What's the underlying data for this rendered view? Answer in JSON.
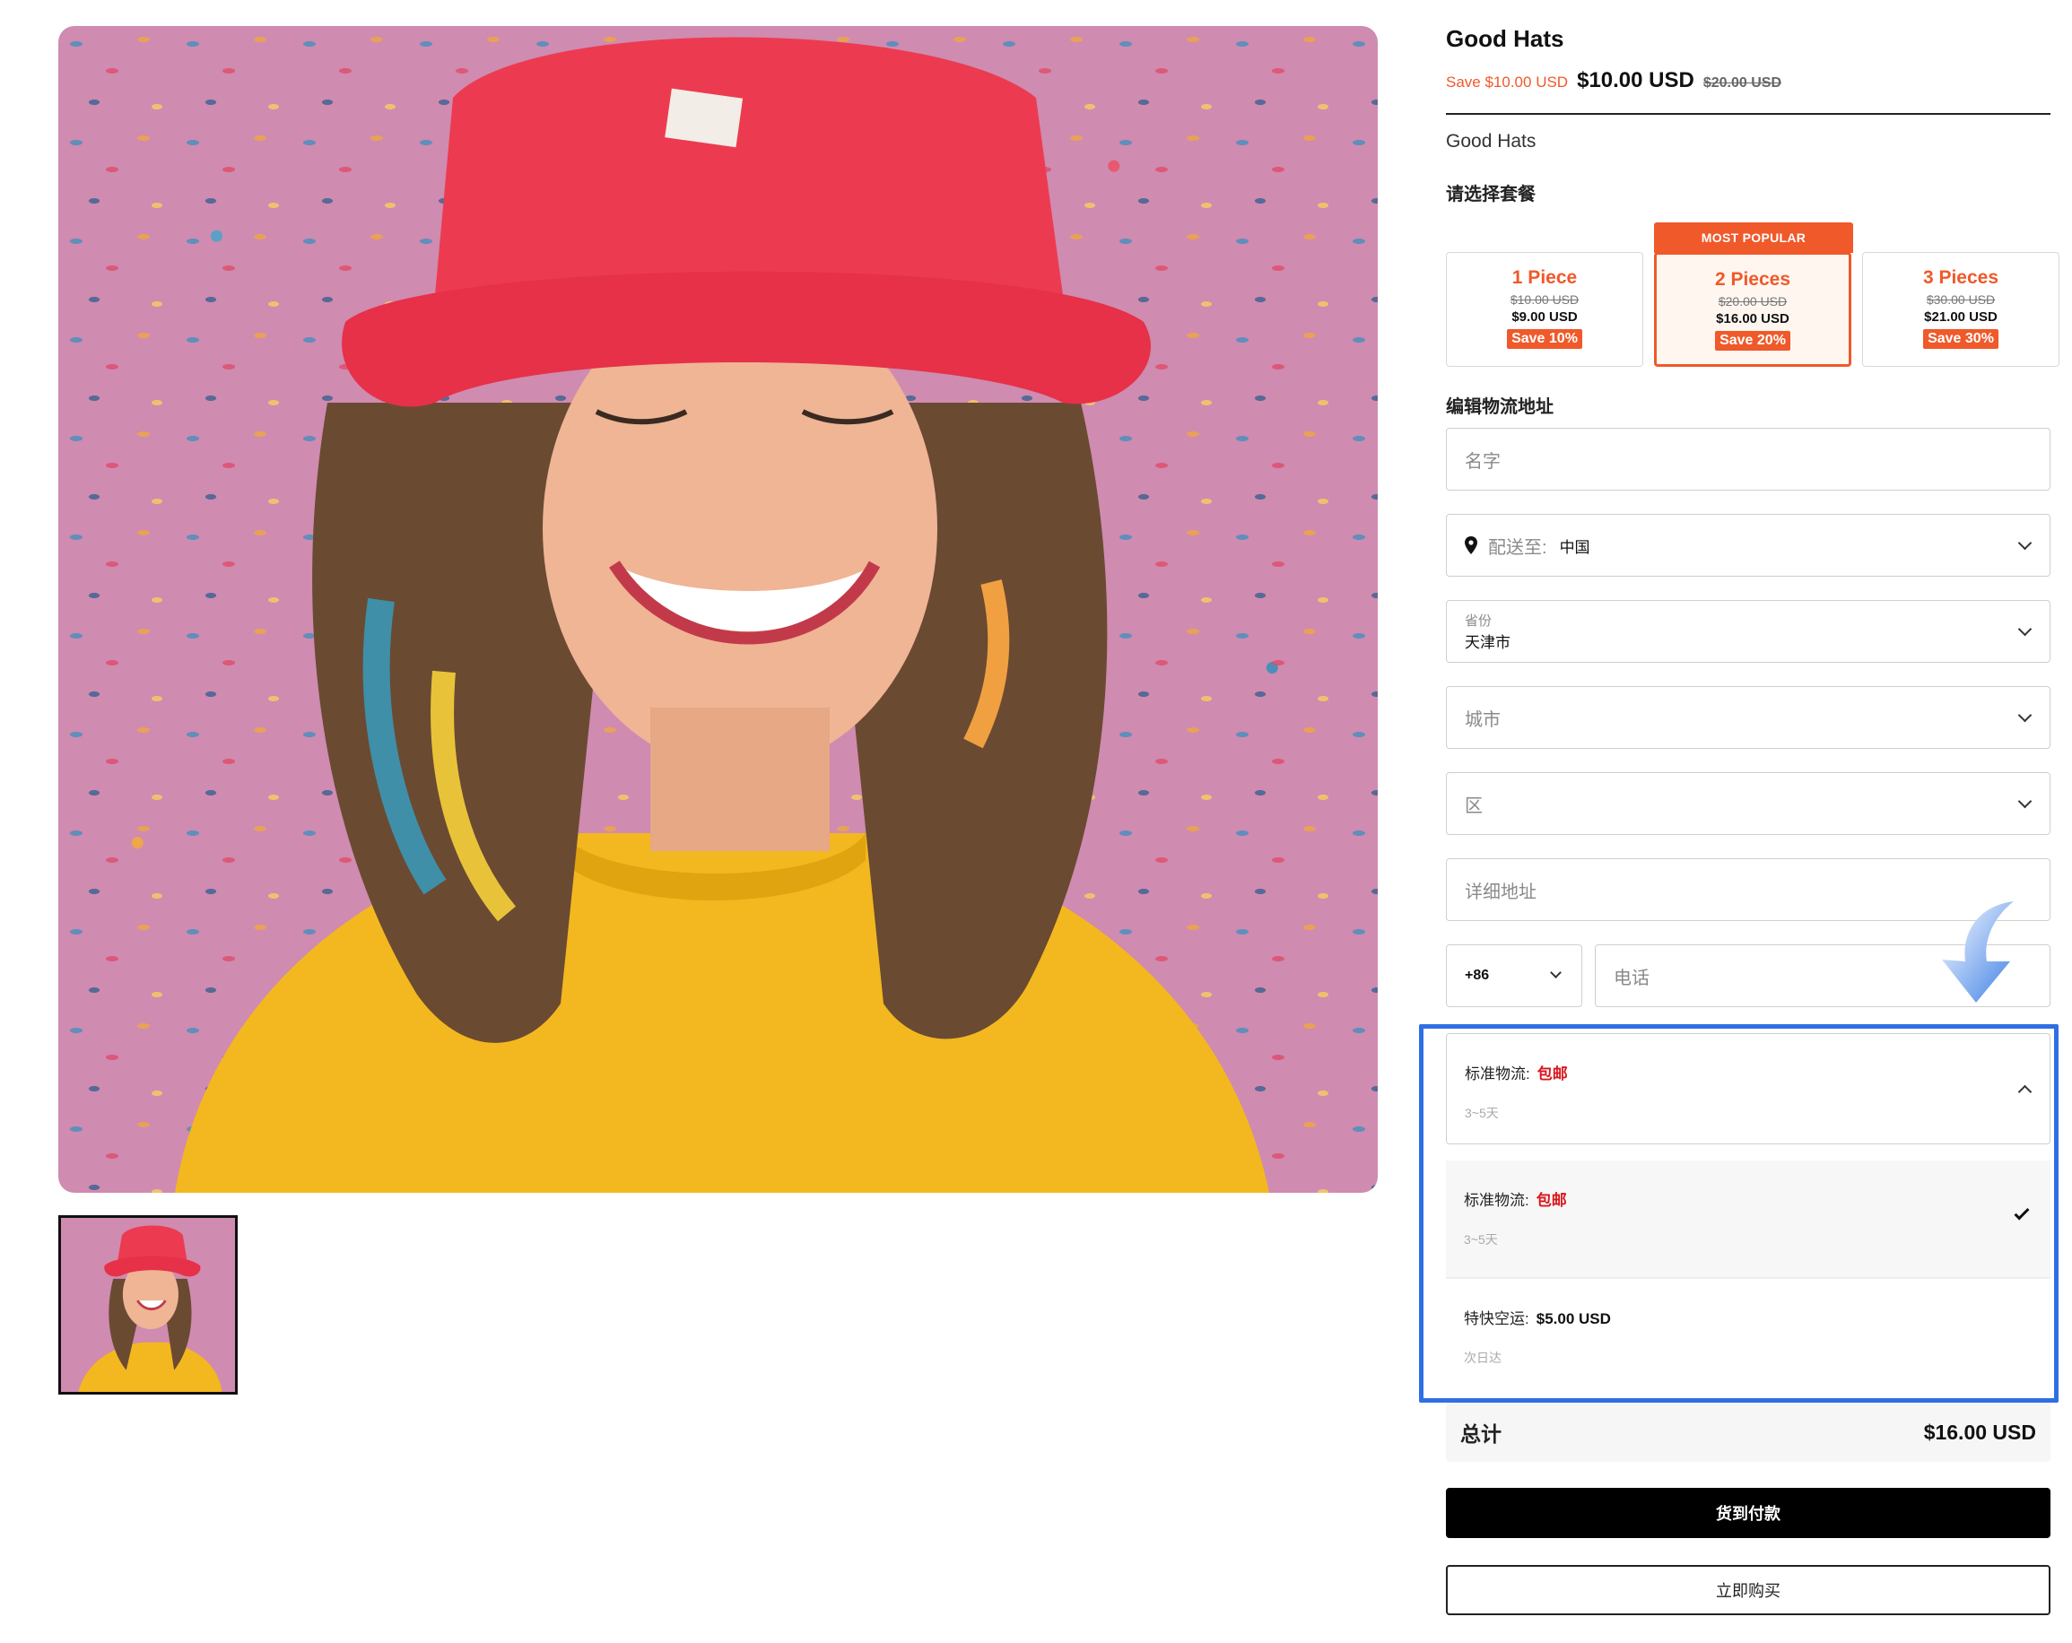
{
  "product": {
    "title": "Good Hats",
    "save_text": "Save $10.00 USD",
    "price": "$10.00 USD",
    "compare_price": "$20.00 USD",
    "subtitle": "Good Hats"
  },
  "bundle_section": {
    "label": "请选择套餐",
    "badge": "MOST POPULAR",
    "options": [
      {
        "name": "1 Piece",
        "old": "$10.00 USD",
        "new": "$9.00 USD",
        "save": "Save 10%"
      },
      {
        "name": "2 Pieces",
        "old": "$20.00 USD",
        "new": "$16.00 USD",
        "save": "Save 20%"
      },
      {
        "name": "3 Pieces",
        "old": "$30.00 USD",
        "new": "$21.00 USD",
        "save": "Save 30%"
      }
    ],
    "selected_index": 1
  },
  "address": {
    "label": "编辑物流地址",
    "name_placeholder": "名字",
    "country_label": "配送至:",
    "country_value": "中国",
    "province_label": "省份",
    "province_value": "天津市",
    "city_placeholder": "城市",
    "district_placeholder": "区",
    "detail_placeholder": "详细地址",
    "phone_code": "+86",
    "phone_placeholder": "电话"
  },
  "shipping": {
    "selected": {
      "name": "标准物流:",
      "price": "包邮",
      "time": "3~5天"
    },
    "options": [
      {
        "name": "标准物流:",
        "price": "包邮",
        "time": "3~5天",
        "checked": true
      },
      {
        "name": "特快空运:",
        "price": "$5.00 USD",
        "time": "次日达",
        "checked": false
      }
    ]
  },
  "total": {
    "label": "总计",
    "value": "$16.00 USD"
  },
  "buttons": {
    "cod": "货到付款",
    "buy_now": "立即购买"
  },
  "colors": {
    "accent": "#f0592a",
    "free_shipping": "#d9151b",
    "highlight": "#2f6fe4",
    "arrow": "#4a86e8"
  }
}
